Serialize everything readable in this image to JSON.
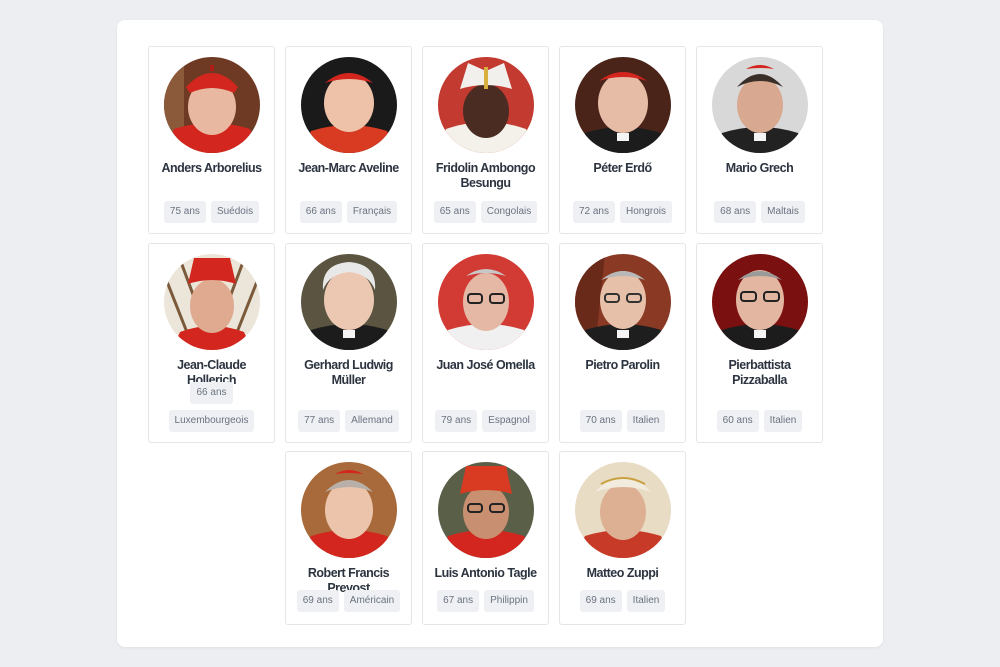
{
  "cardinals": [
    {
      "name": "Anders Arborelius",
      "age": "75 ans",
      "nationality": "Suédois"
    },
    {
      "name": "Jean-Marc Aveline",
      "age": "66 ans",
      "nationality": "Français"
    },
    {
      "name": "Fridolin Ambongo Besungu",
      "age": "65 ans",
      "nationality": "Congolais"
    },
    {
      "name": "Péter Erdő",
      "age": "72 ans",
      "nationality": "Hongrois"
    },
    {
      "name": "Mario Grech",
      "age": "68 ans",
      "nationality": "Maltais"
    },
    {
      "name": "Jean-Claude Hollerich",
      "age": "66 ans",
      "nationality": "Luxembourgeois"
    },
    {
      "name": "Gerhard Ludwig Müller",
      "age": "77 ans",
      "nationality": "Allemand"
    },
    {
      "name": "Juan José Omella",
      "age": "79 ans",
      "nationality": "Espagnol"
    },
    {
      "name": "Pietro Parolin",
      "age": "70 ans",
      "nationality": "Italien"
    },
    {
      "name": "Pierbattista Pizzaballa",
      "age": "60 ans",
      "nationality": "Italien"
    },
    {
      "name": "Robert Francis Prevost",
      "age": "69 ans",
      "nationality": "Américain"
    },
    {
      "name": "Luis Antonio Tagle",
      "age": "67 ans",
      "nationality": "Philippin"
    },
    {
      "name": "Matteo Zuppi",
      "age": "69 ans",
      "nationality": "Italien"
    }
  ],
  "colors": {
    "page_background": "#eceef1",
    "panel": "#ffffff",
    "cardinal_red": "#d2261f",
    "tag_background": "#eef0f3",
    "tag_text": "#6b7380",
    "name_text": "#2c3440"
  }
}
